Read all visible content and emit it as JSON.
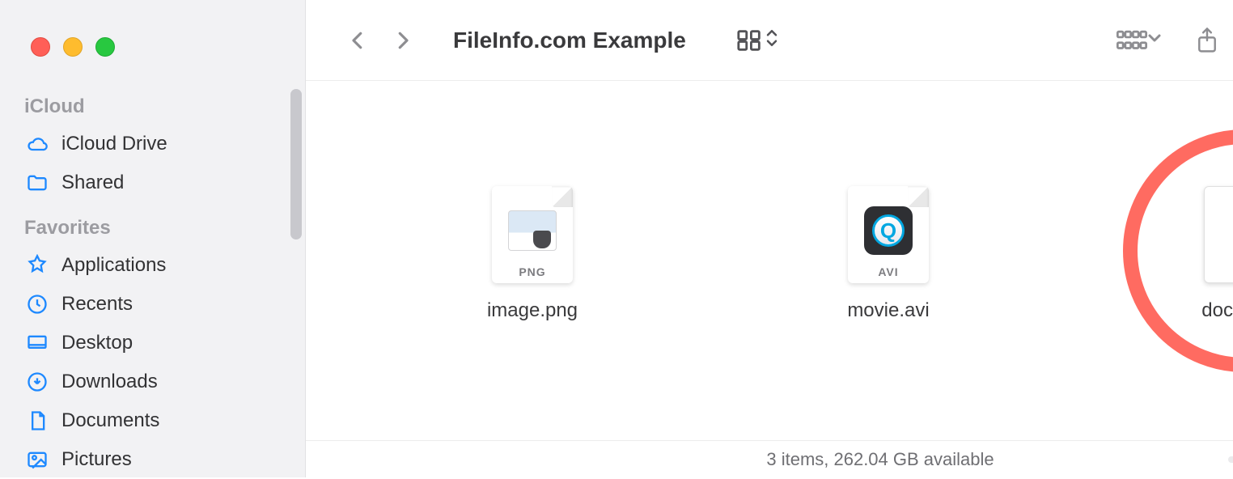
{
  "sidebar": {
    "sections": [
      {
        "header": "iCloud",
        "items": [
          {
            "label": "iCloud Drive",
            "icon": "cloud-icon"
          },
          {
            "label": "Shared",
            "icon": "shared-folder-icon"
          }
        ]
      },
      {
        "header": "Favorites",
        "items": [
          {
            "label": "Applications",
            "icon": "applications-icon"
          },
          {
            "label": "Recents",
            "icon": "clock-icon"
          },
          {
            "label": "Desktop",
            "icon": "desktop-icon"
          },
          {
            "label": "Downloads",
            "icon": "download-icon"
          },
          {
            "label": "Documents",
            "icon": "document-icon"
          },
          {
            "label": "Pictures",
            "icon": "picture-icon"
          }
        ]
      }
    ]
  },
  "toolbar": {
    "title": "FileInfo.com Example"
  },
  "files": [
    {
      "name": "image.png",
      "badge": "PNG",
      "kind": "png"
    },
    {
      "name": "movie.avi",
      "badge": "AVI",
      "kind": "avi"
    },
    {
      "name": "document",
      "badge": "",
      "kind": "blank"
    }
  ],
  "status": {
    "text": "3 items, 262.04 GB available"
  },
  "annotation": {
    "target_file_index": 2
  }
}
